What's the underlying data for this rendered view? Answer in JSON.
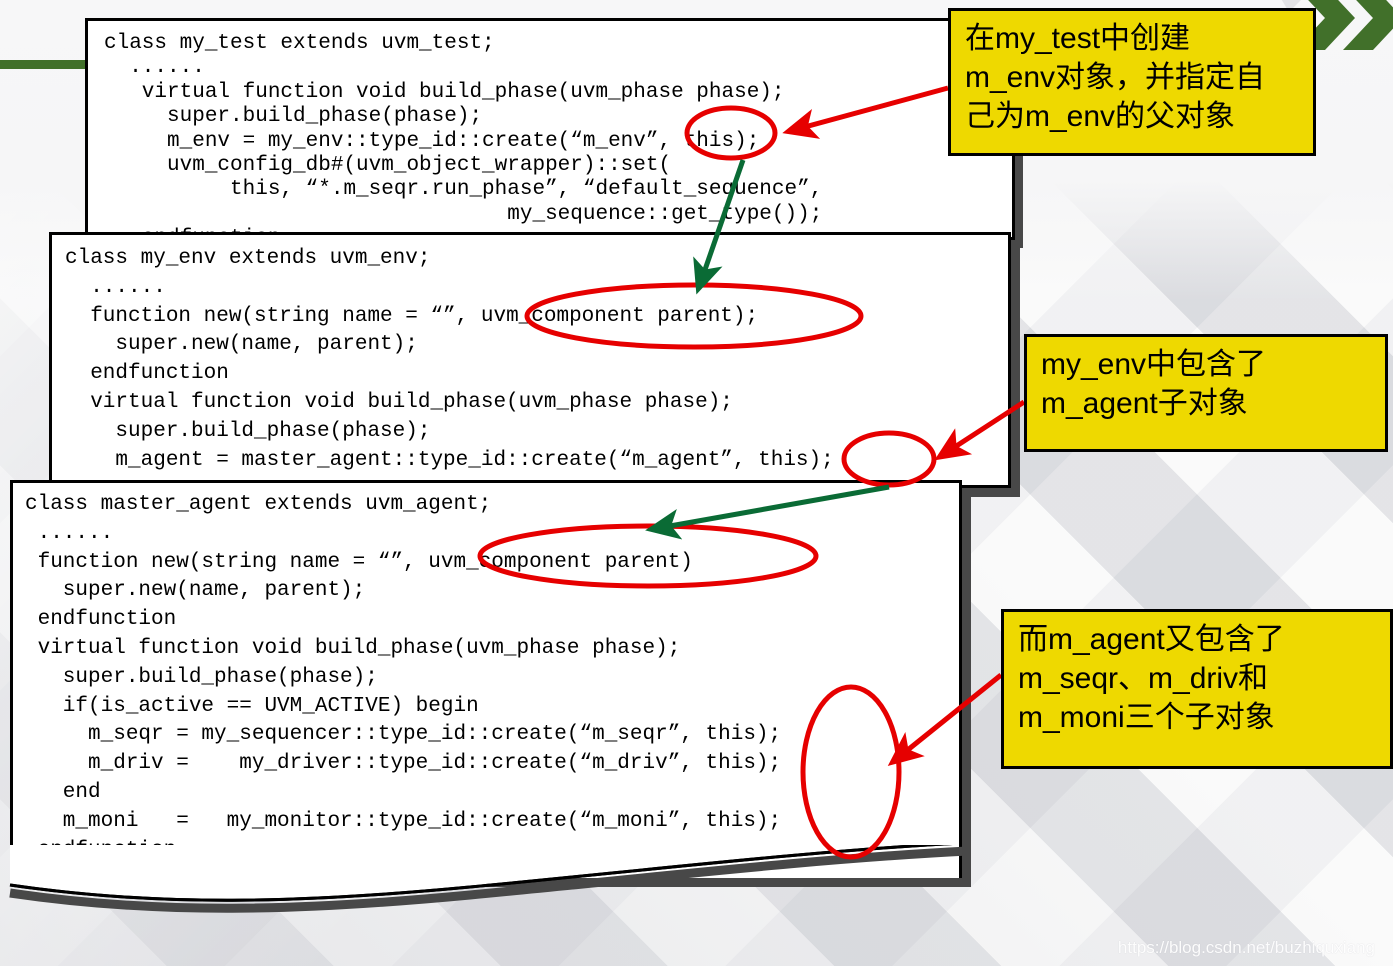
{
  "slide": {
    "watermark": "https://blog.csdn.net/buzhiquxiang",
    "colors": {
      "callout_fill": "#eed900",
      "callout_border": "#000000",
      "ellipse_stroke": "#e60000",
      "red_arrow": "#e60000",
      "green_arrow": "#0a6b35",
      "chevron_green": "#41702a",
      "bar_green": "#41702a",
      "box_border": "#000000",
      "box_shadow": "#484848",
      "background": "#eceded"
    }
  },
  "code_boxes": [
    {
      "id": "my_test",
      "title": "class my_test",
      "code": "class my_test extends uvm_test;\n  ......\n   virtual function void build_phase(uvm_phase phase);\n     super.build_phase(phase);\n     m_env = my_env::type_id::create(“m_env”, this);\n     uvm_config_db#(uvm_object_wrapper)::set(\n          this, “*.m_seqr.run_phase”, “default_sequence”,\n                                my_sequence::get_type());\n   endfunction"
    },
    {
      "id": "my_env",
      "title": "class my_env",
      "code": "class my_env extends uvm_env;\n  ......\n  function new(string name = “”, uvm_component parent);\n    super.new(name, parent);\n  endfunction\n  virtual function void build_phase(uvm_phase phase);\n    super.build_phase(phase);\n    m_agent = master_agent::type_id::create(“m_agent”, this);"
    },
    {
      "id": "master_agent",
      "title": "class master_agent",
      "code": "class master_agent extends uvm_agent;\n ......\n function new(string name = “”, uvm_component parent)\n   super.new(name, parent);\n endfunction\n virtual function void build_phase(uvm_phase phase);\n   super.build_phase(phase);\n   if(is_active == UVM_ACTIVE) begin\n     m_seqr = my_sequencer::type_id::create(“m_seqr”, this);\n     m_driv =    my_driver::type_id::create(“m_driv”, this);\n   end\n   m_moni   =   my_monitor::type_id::create(“m_moni”, this);\n endfunction\nendclass"
    }
  ],
  "callouts": [
    {
      "id": "callout-my-test",
      "text": "在my_test中创建\nm_env对象，并指定自\n己为m_env的父对象"
    },
    {
      "id": "callout-my-env",
      "text": "my_env中包含了\nm_agent子对象"
    },
    {
      "id": "callout-master-agent",
      "text": "而m_agent又包含了\nm_seqr、m_driv和\nm_moni三个子对象"
    }
  ],
  "annotations": {
    "ellipses": [
      {
        "name": "ellipse-this-my-test",
        "label": "this);"
      },
      {
        "name": "ellipse-parent-my-env",
        "label": "uvm_component parent);"
      },
      {
        "name": "ellipse-this-my-agent",
        "label": "this)"
      },
      {
        "name": "ellipse-parent-master",
        "label": "uvm_component parent)"
      },
      {
        "name": "ellipse-this-subobjects",
        "label": "this); this); this);"
      }
    ],
    "red_arrows": [
      {
        "name": "red-arrow-to-my-test-this"
      },
      {
        "name": "red-arrow-to-my-agent-this"
      },
      {
        "name": "red-arrow-to-subobject-this"
      }
    ],
    "green_arrows": [
      {
        "name": "green-arrow-test-to-env"
      },
      {
        "name": "green-arrow-env-to-agent"
      }
    ]
  }
}
